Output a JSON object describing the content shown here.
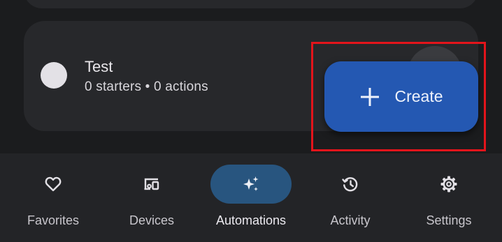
{
  "routine": {
    "title": "Test",
    "subtitle": "0 starters • 0 actions"
  },
  "fab": {
    "icon": "plus-icon",
    "label": "Create"
  },
  "nav": {
    "items": [
      {
        "label": "Favorites",
        "icon": "heart-icon"
      },
      {
        "label": "Devices",
        "icon": "devices-icon"
      },
      {
        "label": "Automations",
        "icon": "sparkle-icon",
        "active": true
      },
      {
        "label": "Activity",
        "icon": "history-icon"
      },
      {
        "label": "Settings",
        "icon": "gear-icon"
      }
    ]
  },
  "colors": {
    "background": "#1b1c1e",
    "card": "#27282b",
    "fab": "#2458b2",
    "active_pill": "#28557f",
    "highlight": "#e3141b"
  }
}
